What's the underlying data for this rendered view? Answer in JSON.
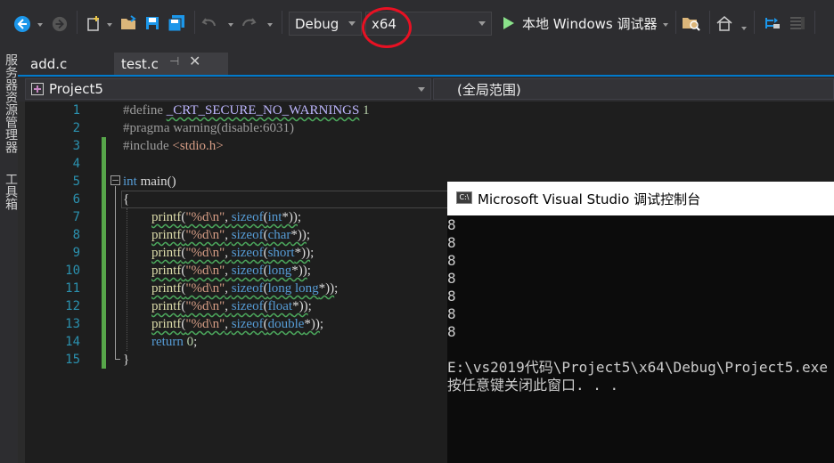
{
  "toolbar": {
    "configuration": "Debug",
    "platform": "x64",
    "run_label": "本地 Windows 调试器",
    "icons": [
      "back-icon",
      "forward-icon",
      "new-project-icon",
      "open-file-icon",
      "save-icon",
      "save-all-icon",
      "undo-icon",
      "redo-icon",
      "play-icon",
      "find-in-files-icon",
      "home-icon",
      "step-icon",
      "comment-icon"
    ]
  },
  "side_tabs": [
    "服务器资源管理器",
    "工具箱"
  ],
  "tabs": [
    {
      "label": "add.c"
    },
    {
      "label": "test.c"
    }
  ],
  "nav": {
    "project": "Project5",
    "scope": "(全局范围)"
  },
  "line_numbers": [
    "1",
    "2",
    "3",
    "4",
    "5",
    "6",
    "7",
    "8",
    "9",
    "10",
    "11",
    "12",
    "13",
    "14",
    "15"
  ],
  "code": {
    "l1_directive": "#define ",
    "l1_macro": "_CRT_SECURE_NO_WARNINGS",
    "l1_value": " 1",
    "l2": "#pragma warning(disable:6031)",
    "l3_directive": "#include ",
    "l3_header": "<stdio.h>",
    "l5_kw": "int",
    "l5_rest": " main()",
    "l6": "{",
    "printf_fn": "printf",
    "fmt": "\"%d\\n\"",
    "sizeof_kw": "sizeof",
    "types": [
      "int",
      "char",
      "short",
      "long",
      "long long",
      "float",
      "double"
    ],
    "l14_kw": "return",
    "l14_num": "0",
    "l15": "}"
  },
  "console": {
    "title": "Microsoft Visual Studio 调试控制台",
    "output": [
      "8",
      "8",
      "8",
      "8",
      "8",
      "8",
      "8"
    ],
    "path_line": "E:\\vs2019代码\\Project5\\x64\\Debug\\Project5.exe",
    "close_msg": "按任意键关闭此窗口. . ."
  },
  "colors": {
    "accent": "#007acc",
    "highlight_circle": "#e81123",
    "keyword": "#569cd6",
    "function": "#dcdcaa",
    "string": "#d69d85",
    "line_number": "#2b91af"
  }
}
